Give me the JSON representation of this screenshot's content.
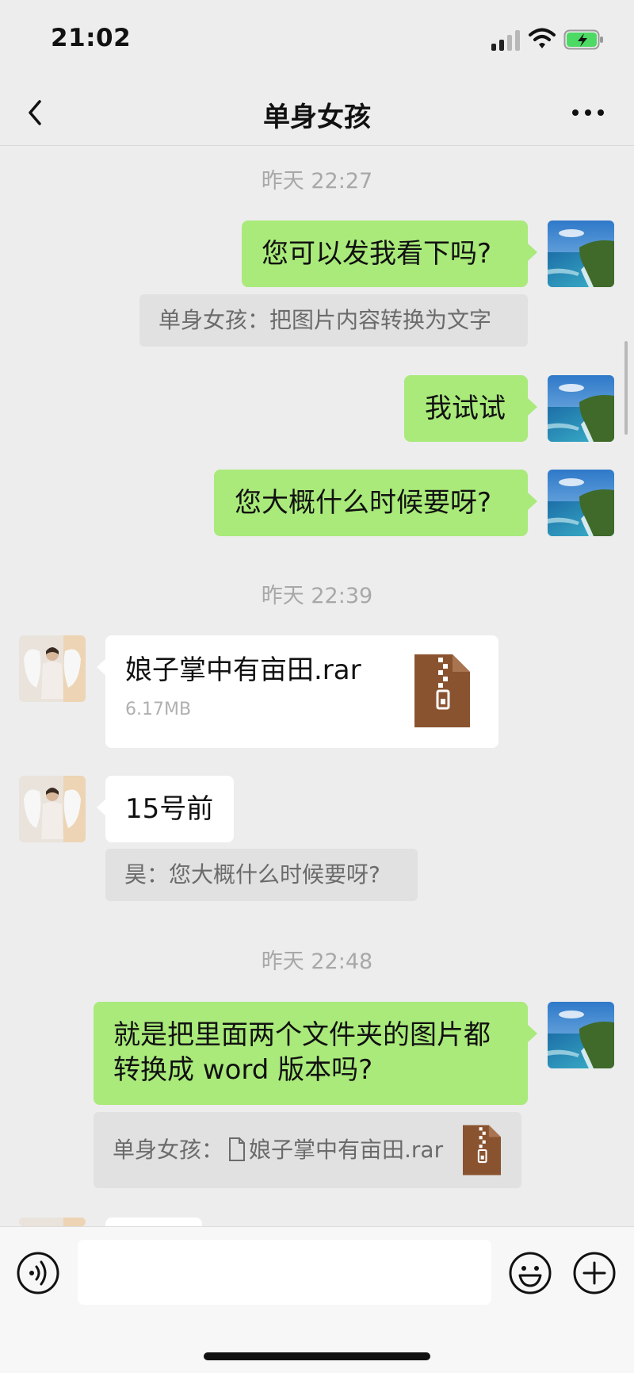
{
  "status_bar": {
    "time": "21:02"
  },
  "header": {
    "title": "单身女孩"
  },
  "messages": {
    "ts1": "昨天 22:27",
    "m1": "您可以发我看下吗?",
    "q1": "单身女孩：把图片内容转换为文字",
    "m2": "我试试",
    "m3": "您大概什么时候要呀?",
    "ts2": "昨天 22:39",
    "file": {
      "name": "娘子掌中有亩田.rar",
      "size": "6.17MB"
    },
    "m4": "15号前",
    "q2": "昊：您大概什么时候要呀?",
    "ts3": "昨天 22:48",
    "m5_line1": "就是把里面两个文件夹的图片都",
    "m5_line2": "转换成 word 版本吗?",
    "q3_prefix": "单身女孩：",
    "q3_file": "娘子掌中有亩田.rar"
  },
  "colors": {
    "background": "#ededed",
    "my_bubble": "#a9ea7a",
    "their_bubble": "#ffffff",
    "quote_bg": "#e1e1e1",
    "archive_icon": "#8a5330"
  },
  "icons": {
    "back": "chevron-left-icon",
    "more": "more-dots-icon",
    "voice": "voice-icon",
    "emoji": "emoji-icon",
    "plus": "plus-icon",
    "archive": "archive-file-icon"
  }
}
